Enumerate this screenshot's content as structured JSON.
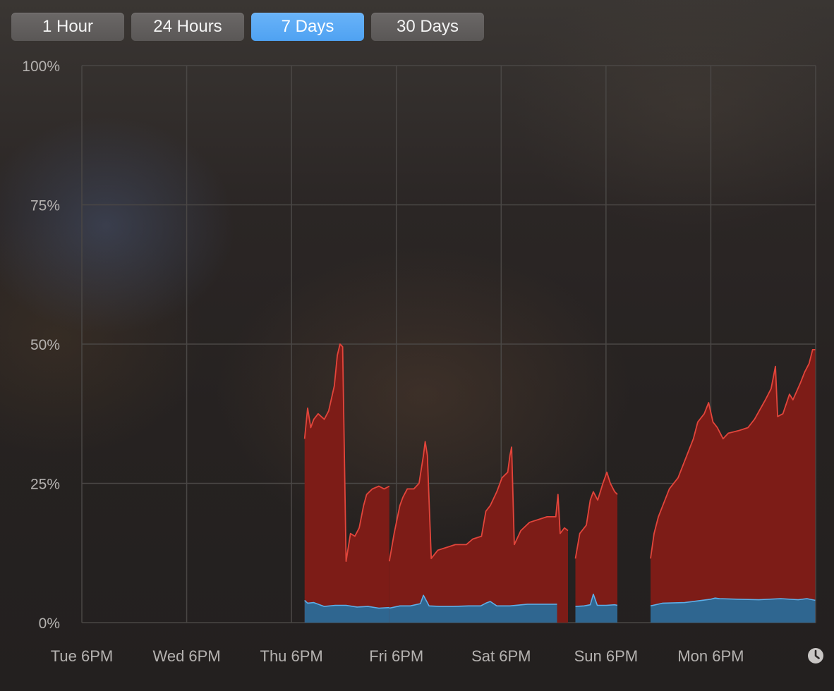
{
  "range_tabs": [
    {
      "label": "1 Hour",
      "selected": false
    },
    {
      "label": "24 Hours",
      "selected": false
    },
    {
      "label": "7 Days",
      "selected": true
    },
    {
      "label": "30 Days",
      "selected": false
    }
  ],
  "icons": {
    "clock": "clock-icon"
  },
  "colors": {
    "red_fill": "#7d1c17",
    "red_line": "#e2453b",
    "blue_fill": "#2f6690",
    "blue_line": "#5dafe8",
    "grid": "#4a4745",
    "tab_selected": "#5aaaf5"
  },
  "chart_data": {
    "type": "area",
    "y_ticks": [
      "100%",
      "75%",
      "50%",
      "25%",
      "0%"
    ],
    "ylim": [
      0,
      100
    ],
    "x_ticks": [
      "Tue 6PM",
      "Wed 6PM",
      "Thu 6PM",
      "Fri 6PM",
      "Sat 6PM",
      "Sun 6PM",
      "Mon 6PM"
    ],
    "x_unit": "hours since Tue 6PM",
    "xlim": [
      0,
      168
    ],
    "grid": true,
    "stacked": true,
    "series": [
      {
        "segments": [
          [
            [
              51.0,
              4
            ],
            [
              51.7,
              3.5
            ],
            [
              53.1,
              3.6
            ],
            [
              55.5,
              2.9
            ],
            [
              58.0,
              3.1
            ],
            [
              60.5,
              3.1
            ],
            [
              63.0,
              2.8
            ],
            [
              65.5,
              2.9
            ],
            [
              68.0,
              2.6
            ],
            [
              70.4,
              2.7
            ]
          ],
          [
            [
              70.4,
              2.6
            ],
            [
              72.8,
              3.0
            ],
            [
              75.2,
              3.0
            ],
            [
              77.5,
              3.4
            ],
            [
              78.2,
              4.9
            ],
            [
              79.5,
              3.0
            ],
            [
              82.0,
              2.9
            ],
            [
              85.0,
              2.9
            ],
            [
              88.5,
              3.0
            ],
            [
              91.3,
              3.0
            ],
            [
              92.5,
              3.5
            ],
            [
              93.5,
              3.8
            ],
            [
              95.0,
              3.0
            ],
            [
              98.0,
              3.0
            ],
            [
              102.0,
              3.3
            ],
            [
              104.5,
              3.3
            ],
            [
              108.8,
              3.3
            ]
          ],
          [
            [
              113.0,
              2.9
            ],
            [
              115.0,
              3.0
            ],
            [
              116.4,
              3.2
            ],
            [
              117.1,
              5.1
            ],
            [
              118.0,
              3.1
            ],
            [
              120.0,
              3.1
            ],
            [
              122.0,
              3.2
            ],
            [
              122.6,
              3.1
            ]
          ],
          [
            [
              130.2,
              3.0
            ],
            [
              133.0,
              3.5
            ],
            [
              138.0,
              3.6
            ],
            [
              142.0,
              4.0
            ],
            [
              144.0,
              4.2
            ],
            [
              145.0,
              4.4
            ],
            [
              146.0,
              4.3
            ],
            [
              150.0,
              4.2
            ],
            [
              155.0,
              4.1
            ],
            [
              160.0,
              4.3
            ],
            [
              164.0,
              4.1
            ],
            [
              166.0,
              4.3
            ],
            [
              167.9,
              4.0
            ]
          ]
        ]
      },
      {
        "segments": [
          [
            [
              51.0,
              33
            ],
            [
              51.7,
              38.5
            ],
            [
              52.4,
              35
            ],
            [
              53.1,
              36.5
            ],
            [
              54.1,
              37.5
            ],
            [
              55.5,
              36.5
            ],
            [
              56.5,
              38
            ],
            [
              57.8,
              42.5
            ],
            [
              58.5,
              48
            ],
            [
              59.1,
              50
            ],
            [
              59.7,
              49.5
            ],
            [
              60.5,
              11
            ],
            [
              61.5,
              16
            ],
            [
              62.5,
              15.5
            ],
            [
              63.5,
              17
            ],
            [
              64.5,
              21
            ],
            [
              65.2,
              23
            ],
            [
              66.5,
              24
            ],
            [
              68.0,
              24.5
            ],
            [
              69.2,
              24
            ],
            [
              70.4,
              24.5
            ]
          ],
          [
            [
              70.4,
              11
            ],
            [
              71.5,
              16
            ],
            [
              72.8,
              21
            ],
            [
              73.5,
              22.5
            ],
            [
              74.5,
              24
            ],
            [
              76.0,
              24
            ],
            [
              77.2,
              25
            ],
            [
              78.2,
              30
            ],
            [
              78.6,
              32.5
            ],
            [
              79.1,
              30
            ],
            [
              80.0,
              11.5
            ],
            [
              81.5,
              13
            ],
            [
              83.5,
              13.5
            ],
            [
              85.5,
              14
            ],
            [
              88.0,
              14
            ],
            [
              89.5,
              15
            ],
            [
              91.5,
              15.5
            ],
            [
              92.5,
              20
            ],
            [
              93.5,
              21
            ],
            [
              95.0,
              23.5
            ],
            [
              96.2,
              26
            ],
            [
              97.5,
              27
            ],
            [
              98.0,
              30
            ],
            [
              98.4,
              31.5
            ],
            [
              99.0,
              14
            ],
            [
              100.5,
              16.5
            ],
            [
              102.5,
              18
            ],
            [
              104.5,
              18.5
            ],
            [
              106.5,
              19
            ],
            [
              108.5,
              19
            ],
            [
              109.0,
              23
            ],
            [
              109.5,
              16
            ],
            [
              110.5,
              17
            ],
            [
              111.3,
              16.5
            ]
          ],
          [
            [
              113.0,
              11.5
            ],
            [
              114.0,
              16
            ],
            [
              115.5,
              17.5
            ],
            [
              116.4,
              22
            ],
            [
              117.1,
              23.5
            ],
            [
              118.1,
              22
            ],
            [
              119.3,
              25
            ],
            [
              120.2,
              27
            ],
            [
              121.0,
              25
            ],
            [
              122.0,
              23.5
            ],
            [
              122.6,
              23
            ]
          ],
          [
            [
              130.2,
              11.5
            ],
            [
              131.0,
              16
            ],
            [
              132.0,
              19
            ],
            [
              133.0,
              21
            ],
            [
              134.5,
              24
            ],
            [
              136.5,
              26
            ],
            [
              137.5,
              28
            ],
            [
              138.5,
              30
            ],
            [
              140.0,
              33
            ],
            [
              141.0,
              36
            ],
            [
              142.5,
              37.5
            ],
            [
              143.5,
              39.5
            ],
            [
              144.5,
              36
            ],
            [
              145.5,
              35
            ],
            [
              146.8,
              33
            ],
            [
              148.0,
              34
            ],
            [
              150.5,
              34.5
            ],
            [
              152.5,
              35
            ],
            [
              154.0,
              36.5
            ],
            [
              156.5,
              40
            ],
            [
              157.8,
              42
            ],
            [
              158.8,
              46
            ],
            [
              159.3,
              37
            ],
            [
              160.5,
              37.5
            ],
            [
              162.0,
              41
            ],
            [
              162.8,
              40
            ],
            [
              164.5,
              43
            ],
            [
              165.5,
              45
            ],
            [
              166.5,
              46.5
            ],
            [
              167.3,
              49
            ],
            [
              167.9,
              49
            ]
          ]
        ]
      }
    ]
  }
}
